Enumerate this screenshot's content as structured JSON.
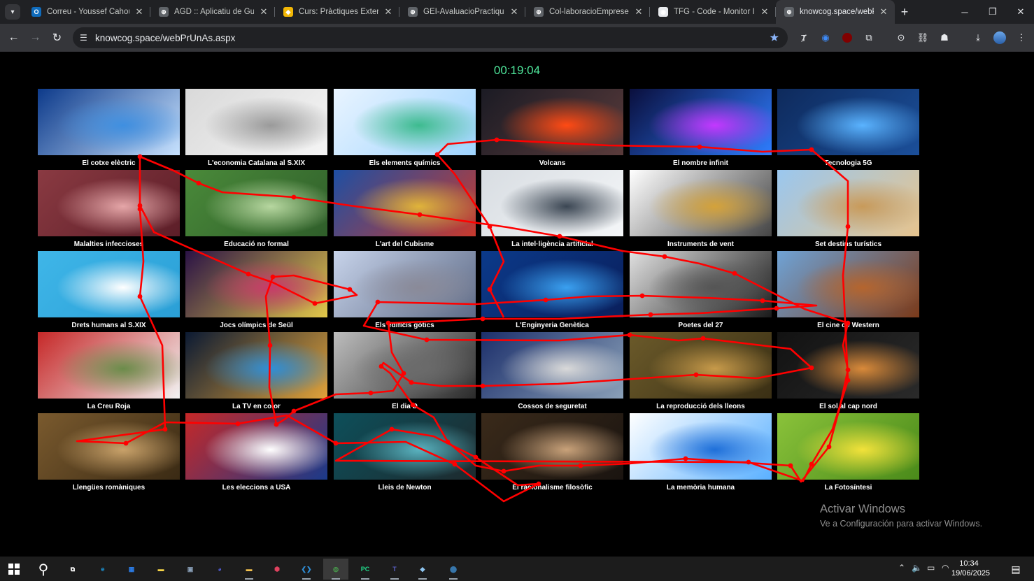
{
  "browser": {
    "tabs": [
      {
        "title": "Correu - Youssef Cahouach",
        "favicon_color": "#0f6cbd",
        "favicon_glyph": "O"
      },
      {
        "title": "AGD :: Aplicatiu de Guies",
        "favicon_color": "#5f6368",
        "favicon_glyph": "⊕"
      },
      {
        "title": "Curs: Pràctiques Externes",
        "favicon_color": "#f2b705",
        "favicon_glyph": "◆"
      },
      {
        "title": "GEI-AvaluacioPractiquesEx",
        "favicon_color": "#5f6368",
        "favicon_glyph": "⊕"
      },
      {
        "title": "Col-laboracioEmpresesEN",
        "favicon_color": "#5f6368",
        "favicon_glyph": "⊕"
      },
      {
        "title": "TFG - Code - Monitor Indi",
        "favicon_color": "#e8eaed",
        "favicon_glyph": "◉"
      },
      {
        "title": "knowcog.space/webPrUnAs",
        "favicon_color": "#5f6368",
        "favicon_glyph": "⊕",
        "active": true
      }
    ],
    "url": "knowcog.space/webPrUnAs.aspx"
  },
  "page": {
    "timer": "00:19:04",
    "tiles": [
      {
        "label": "El cotxe elèctric",
        "icon": "electric-car",
        "colors": [
          "#0d3a8a",
          "#3f8fe0",
          "#c7e2ff"
        ]
      },
      {
        "label": "L'economia Catalana al S.XIX",
        "icon": "textile-factory",
        "colors": [
          "#d9d9d9",
          "#9a9a9a",
          "#f5f5f5"
        ]
      },
      {
        "label": "Els elements químics",
        "icon": "chemistry-flask",
        "colors": [
          "#e9f4ff",
          "#3dbb8f",
          "#9fd4ff"
        ]
      },
      {
        "label": "Volcans",
        "icon": "volcano",
        "colors": [
          "#1b1b24",
          "#ff4a14",
          "#5a3b3b"
        ]
      },
      {
        "label": "El nombre infinit",
        "icon": "infinity-symbol",
        "colors": [
          "#0a0f3d",
          "#c338ff",
          "#2e7dff"
        ]
      },
      {
        "label": "Tecnologia 5G",
        "icon": "city-5g",
        "colors": [
          "#0e2a5c",
          "#5ab3ff",
          "#1b4f9a"
        ]
      },
      {
        "label": "Malalties infeccioses",
        "icon": "bacteria",
        "colors": [
          "#8a3a42",
          "#e5a6a8",
          "#5c1e28"
        ]
      },
      {
        "label": "Educació no formal",
        "icon": "children-playing",
        "colors": [
          "#4a8a3a",
          "#b7d7a0",
          "#2f5e2a"
        ]
      },
      {
        "label": "L'art del Cubisme",
        "icon": "cubist-painting",
        "colors": [
          "#1e4fa3",
          "#e0b43a",
          "#c83a2e"
        ]
      },
      {
        "label": "La intel·ligència artificial",
        "icon": "ai-head",
        "colors": [
          "#d8dde2",
          "#3b4653",
          "#f4f6f8"
        ]
      },
      {
        "label": "Instruments de vent",
        "icon": "wind-instruments",
        "colors": [
          "#ffffff",
          "#d4a23a",
          "#444444"
        ]
      },
      {
        "label": "Set destins turístics",
        "icon": "pyramids",
        "colors": [
          "#9ac7ef",
          "#c89a5a",
          "#e6c48e"
        ]
      },
      {
        "label": "Drets humans al S.XIX",
        "icon": "human-rights-figures",
        "colors": [
          "#3fb6e8",
          "#ffffff",
          "#2a9fd6"
        ]
      },
      {
        "label": "Jocs olímpics de Seül",
        "icon": "olympic-rings",
        "colors": [
          "#2a1245",
          "#c83a6a",
          "#e2c84a"
        ]
      },
      {
        "label": "Els edificis gòtics",
        "icon": "gothic-cathedral",
        "colors": [
          "#c7d3ea",
          "#8a8a98",
          "#5d6a86"
        ]
      },
      {
        "label": "L'Enginyeria Genètica",
        "icon": "dna",
        "colors": [
          "#0b3a8a",
          "#3aa0f0",
          "#0a1f5c"
        ]
      },
      {
        "label": "Poetes del 27",
        "icon": "poets-portraits",
        "colors": [
          "#e0e0e0",
          "#555555",
          "#1a1a1a"
        ]
      },
      {
        "label": "El cine de Western",
        "icon": "desert-landscape",
        "colors": [
          "#6fa3d6",
          "#b5652e",
          "#7a3a1a"
        ]
      },
      {
        "label": "La Creu Roja",
        "icon": "red-cross-volunteers",
        "colors": [
          "#c62828",
          "#6b8c4a",
          "#f2f2f2"
        ]
      },
      {
        "label": "La TV en color",
        "icon": "tv-screens",
        "colors": [
          "#0b1a33",
          "#2f8fd8",
          "#e0a23a"
        ]
      },
      {
        "label": "El dia D",
        "icon": "d-day-soldiers",
        "colors": [
          "#bdbdbd",
          "#6b6b6b",
          "#2a2a2a"
        ]
      },
      {
        "label": "Cossos de seguretat",
        "icon": "police-cars",
        "colors": [
          "#1c2f6b",
          "#d9d9d9",
          "#8aa0b8"
        ]
      },
      {
        "label": "La reproducció dels lleons",
        "icon": "lion",
        "colors": [
          "#6b5a2a",
          "#c79a4a",
          "#3a2f14"
        ]
      },
      {
        "label": "El sol al cap nord",
        "icon": "sunset-cliff",
        "colors": [
          "#121212",
          "#d98a3a",
          "#2a2a2a"
        ]
      },
      {
        "label": "Llengües romàniques",
        "icon": "old-manuscript",
        "colors": [
          "#7a5a2e",
          "#c9a26a",
          "#3a2a14"
        ]
      },
      {
        "label": "Les eleccions a USA",
        "icon": "vote-buttons",
        "colors": [
          "#c62828",
          "#ffffff",
          "#1a3a8a"
        ]
      },
      {
        "label": "Lleis de Newton",
        "icon": "newtons-cradle",
        "colors": [
          "#0d4f5a",
          "#5ab3c0",
          "#1e2a2e"
        ]
      },
      {
        "label": "El racionalisme filosòfic",
        "icon": "philosophers-portraits",
        "colors": [
          "#3a2a1a",
          "#c9a27a",
          "#1a1410"
        ]
      },
      {
        "label": "La memòria humana",
        "icon": "brain",
        "colors": [
          "#ffffff",
          "#1e6fd9",
          "#5ab0ff"
        ]
      },
      {
        "label": "La Fotosíntesi",
        "icon": "leaf-veins",
        "colors": [
          "#8ac23a",
          "#f2e23a",
          "#4a8a1a"
        ]
      }
    ],
    "gaze_trace_color": "#ff0000",
    "activate_windows": {
      "title": "Activar Windows",
      "subtitle": "Ve a Configuración para activar Windows."
    }
  },
  "taskbar": {
    "apps": [
      {
        "name": "task-view",
        "glyph": "⧉",
        "color": "#ffffff"
      },
      {
        "name": "edge",
        "glyph": "e",
        "color": "#1b9de2"
      },
      {
        "name": "store",
        "glyph": "▦",
        "color": "#2b7de9"
      },
      {
        "name": "sticky-notes",
        "glyph": "▬",
        "color": "#f7d547"
      },
      {
        "name": "file-app",
        "glyph": "▣",
        "color": "#8aa0b8"
      },
      {
        "name": "discord",
        "glyph": "◕",
        "color": "#5865f2"
      },
      {
        "name": "file-explorer",
        "glyph": "▬",
        "color": "#f2c14e"
      },
      {
        "name": "app-hex",
        "glyph": "⬢",
        "color": "#e0425f"
      },
      {
        "name": "vscode",
        "glyph": "❮❯",
        "color": "#2f8fd8"
      },
      {
        "name": "chrome",
        "glyph": "◎",
        "color": "#4caf50"
      },
      {
        "name": "pycharm",
        "glyph": "PC",
        "color": "#21d789"
      },
      {
        "name": "teams",
        "glyph": "T",
        "color": "#5b5fc7"
      },
      {
        "name": "notes-app",
        "glyph": "◆",
        "color": "#8ec5f0"
      },
      {
        "name": "python",
        "glyph": "⬤",
        "color": "#3776ab"
      }
    ],
    "time": "10:34",
    "date": "19/06/2025"
  }
}
